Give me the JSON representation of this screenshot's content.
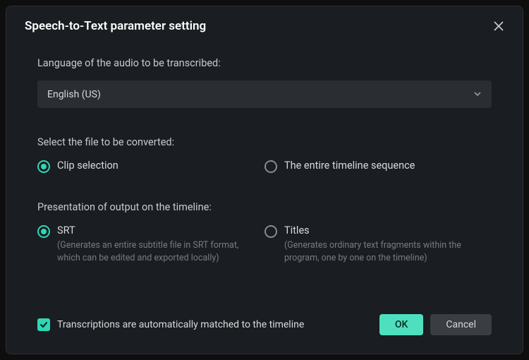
{
  "dialog": {
    "title": "Speech-to-Text parameter setting"
  },
  "language": {
    "label": "Language of the audio to be transcribed:",
    "selected": "English (US)"
  },
  "file_select": {
    "label": "Select the file to be converted:",
    "options": {
      "clip": "Clip selection",
      "timeline": "The entire timeline sequence"
    }
  },
  "output": {
    "label": "Presentation of output on the timeline:",
    "srt": {
      "title": "SRT",
      "desc": "(Generates an entire subtitle file in SRT format, which can be edited and exported locally)"
    },
    "titles": {
      "title": "Titles",
      "desc": "(Generates ordinary text fragments within the program, one by one on the timeline)"
    }
  },
  "footer": {
    "checkbox_label": "Transcriptions are automatically matched to the timeline",
    "ok": "OK",
    "cancel": "Cancel"
  }
}
